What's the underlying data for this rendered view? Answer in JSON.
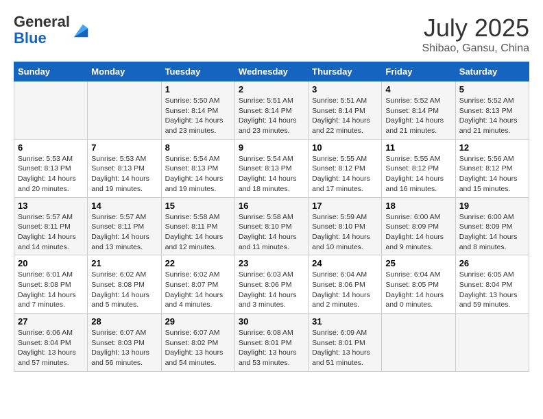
{
  "header": {
    "logo_general": "General",
    "logo_blue": "Blue",
    "month": "July 2025",
    "location": "Shibao, Gansu, China"
  },
  "days_of_week": [
    "Sunday",
    "Monday",
    "Tuesday",
    "Wednesday",
    "Thursday",
    "Friday",
    "Saturday"
  ],
  "weeks": [
    [
      {
        "day": "",
        "content": ""
      },
      {
        "day": "",
        "content": ""
      },
      {
        "day": "1",
        "content": "Sunrise: 5:50 AM\nSunset: 8:14 PM\nDaylight: 14 hours and 23 minutes."
      },
      {
        "day": "2",
        "content": "Sunrise: 5:51 AM\nSunset: 8:14 PM\nDaylight: 14 hours and 23 minutes."
      },
      {
        "day": "3",
        "content": "Sunrise: 5:51 AM\nSunset: 8:14 PM\nDaylight: 14 hours and 22 minutes."
      },
      {
        "day": "4",
        "content": "Sunrise: 5:52 AM\nSunset: 8:14 PM\nDaylight: 14 hours and 21 minutes."
      },
      {
        "day": "5",
        "content": "Sunrise: 5:52 AM\nSunset: 8:13 PM\nDaylight: 14 hours and 21 minutes."
      }
    ],
    [
      {
        "day": "6",
        "content": "Sunrise: 5:53 AM\nSunset: 8:13 PM\nDaylight: 14 hours and 20 minutes."
      },
      {
        "day": "7",
        "content": "Sunrise: 5:53 AM\nSunset: 8:13 PM\nDaylight: 14 hours and 19 minutes."
      },
      {
        "day": "8",
        "content": "Sunrise: 5:54 AM\nSunset: 8:13 PM\nDaylight: 14 hours and 19 minutes."
      },
      {
        "day": "9",
        "content": "Sunrise: 5:54 AM\nSunset: 8:13 PM\nDaylight: 14 hours and 18 minutes."
      },
      {
        "day": "10",
        "content": "Sunrise: 5:55 AM\nSunset: 8:12 PM\nDaylight: 14 hours and 17 minutes."
      },
      {
        "day": "11",
        "content": "Sunrise: 5:55 AM\nSunset: 8:12 PM\nDaylight: 14 hours and 16 minutes."
      },
      {
        "day": "12",
        "content": "Sunrise: 5:56 AM\nSunset: 8:12 PM\nDaylight: 14 hours and 15 minutes."
      }
    ],
    [
      {
        "day": "13",
        "content": "Sunrise: 5:57 AM\nSunset: 8:11 PM\nDaylight: 14 hours and 14 minutes."
      },
      {
        "day": "14",
        "content": "Sunrise: 5:57 AM\nSunset: 8:11 PM\nDaylight: 14 hours and 13 minutes."
      },
      {
        "day": "15",
        "content": "Sunrise: 5:58 AM\nSunset: 8:11 PM\nDaylight: 14 hours and 12 minutes."
      },
      {
        "day": "16",
        "content": "Sunrise: 5:58 AM\nSunset: 8:10 PM\nDaylight: 14 hours and 11 minutes."
      },
      {
        "day": "17",
        "content": "Sunrise: 5:59 AM\nSunset: 8:10 PM\nDaylight: 14 hours and 10 minutes."
      },
      {
        "day": "18",
        "content": "Sunrise: 6:00 AM\nSunset: 8:09 PM\nDaylight: 14 hours and 9 minutes."
      },
      {
        "day": "19",
        "content": "Sunrise: 6:00 AM\nSunset: 8:09 PM\nDaylight: 14 hours and 8 minutes."
      }
    ],
    [
      {
        "day": "20",
        "content": "Sunrise: 6:01 AM\nSunset: 8:08 PM\nDaylight: 14 hours and 7 minutes."
      },
      {
        "day": "21",
        "content": "Sunrise: 6:02 AM\nSunset: 8:08 PM\nDaylight: 14 hours and 5 minutes."
      },
      {
        "day": "22",
        "content": "Sunrise: 6:02 AM\nSunset: 8:07 PM\nDaylight: 14 hours and 4 minutes."
      },
      {
        "day": "23",
        "content": "Sunrise: 6:03 AM\nSunset: 8:06 PM\nDaylight: 14 hours and 3 minutes."
      },
      {
        "day": "24",
        "content": "Sunrise: 6:04 AM\nSunset: 8:06 PM\nDaylight: 14 hours and 2 minutes."
      },
      {
        "day": "25",
        "content": "Sunrise: 6:04 AM\nSunset: 8:05 PM\nDaylight: 14 hours and 0 minutes."
      },
      {
        "day": "26",
        "content": "Sunrise: 6:05 AM\nSunset: 8:04 PM\nDaylight: 13 hours and 59 minutes."
      }
    ],
    [
      {
        "day": "27",
        "content": "Sunrise: 6:06 AM\nSunset: 8:04 PM\nDaylight: 13 hours and 57 minutes."
      },
      {
        "day": "28",
        "content": "Sunrise: 6:07 AM\nSunset: 8:03 PM\nDaylight: 13 hours and 56 minutes."
      },
      {
        "day": "29",
        "content": "Sunrise: 6:07 AM\nSunset: 8:02 PM\nDaylight: 13 hours and 54 minutes."
      },
      {
        "day": "30",
        "content": "Sunrise: 6:08 AM\nSunset: 8:01 PM\nDaylight: 13 hours and 53 minutes."
      },
      {
        "day": "31",
        "content": "Sunrise: 6:09 AM\nSunset: 8:01 PM\nDaylight: 13 hours and 51 minutes."
      },
      {
        "day": "",
        "content": ""
      },
      {
        "day": "",
        "content": ""
      }
    ]
  ]
}
